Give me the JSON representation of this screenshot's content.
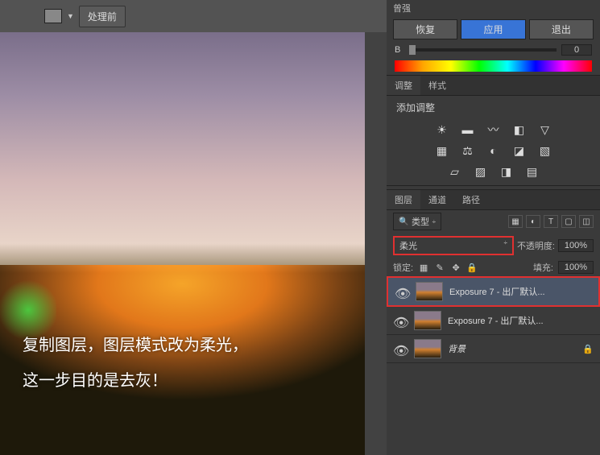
{
  "toolbar": {
    "before_btn": "处理前"
  },
  "canvas": {
    "caption_line1": "复制图层，图层模式改为柔光，",
    "caption_line2": "这一步目的是去灰！"
  },
  "top_panel": {
    "header_label": "曾强",
    "restore_btn": "恢复",
    "apply_btn": "应用",
    "exit_btn": "退出",
    "slider_b_label": "B",
    "slider_b_value": "0"
  },
  "adjust": {
    "tab1": "调整",
    "tab2": "样式",
    "title": "添加调整"
  },
  "layers": {
    "tab_layers": "图层",
    "tab_channels": "通道",
    "tab_paths": "路径",
    "filter_type": "类型",
    "blend_mode": "柔光",
    "opacity_label": "不透明度:",
    "opacity_value": "100%",
    "lock_label": "锁定:",
    "fill_label": "填充:",
    "fill_value": "100%",
    "items": [
      {
        "name": "Exposure 7 - 出厂默认...",
        "selected": true,
        "locked": false
      },
      {
        "name": "Exposure 7 - 出厂默认...",
        "selected": false,
        "locked": false
      },
      {
        "name": "背景",
        "selected": false,
        "locked": true,
        "italic": true
      }
    ]
  }
}
